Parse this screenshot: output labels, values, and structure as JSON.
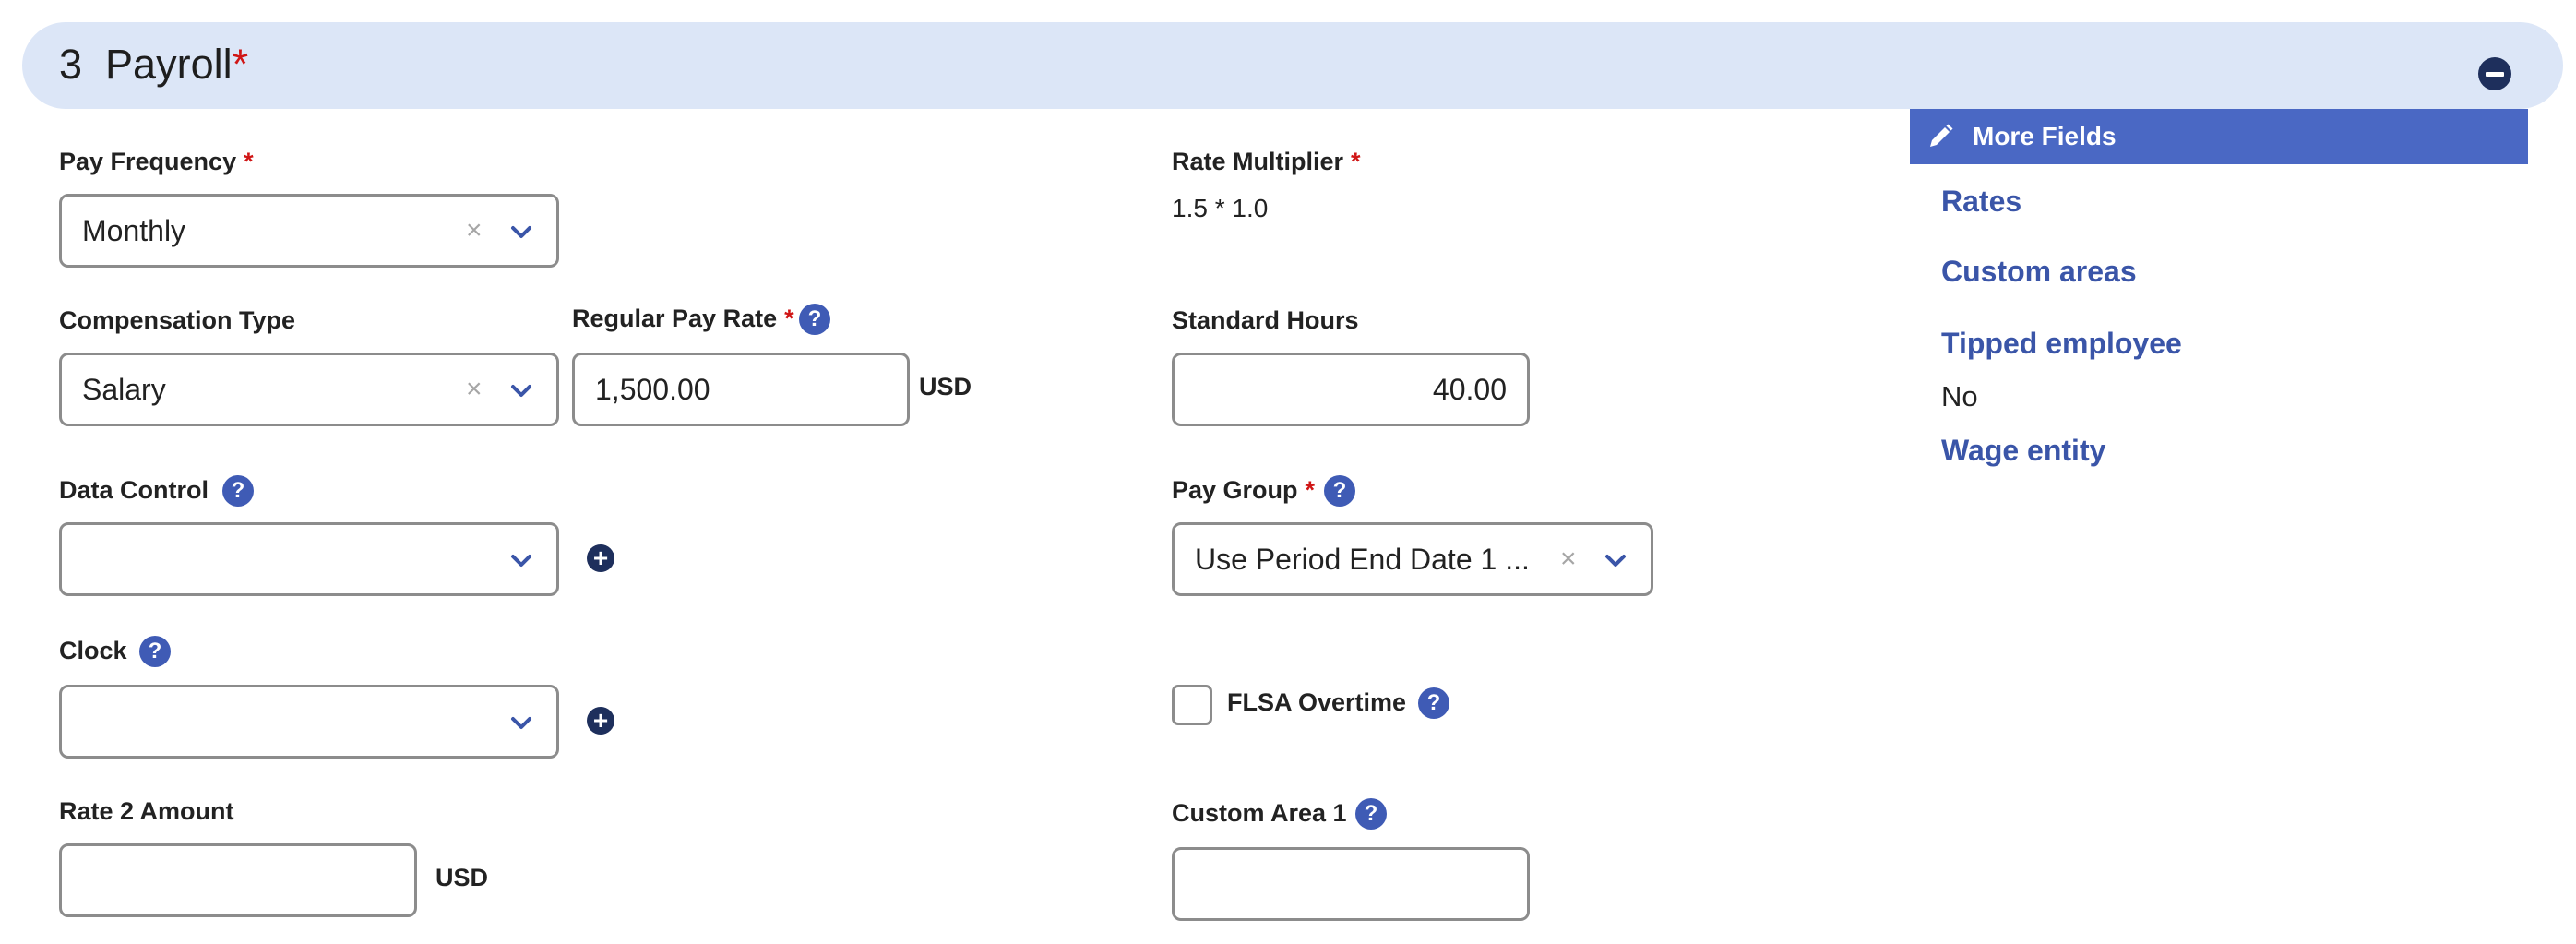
{
  "section": {
    "number": "3",
    "title": "Payroll",
    "required_marker": "*"
  },
  "fields": {
    "pay_frequency": {
      "label": "Pay Frequency",
      "required": "*",
      "value": "Monthly"
    },
    "rate_multiplier": {
      "label": "Rate Multiplier",
      "required": "*",
      "value": "1.5 * 1.0"
    },
    "compensation_type": {
      "label": "Compensation Type",
      "value": "Salary"
    },
    "regular_pay_rate": {
      "label": "Regular Pay Rate",
      "required": "*",
      "value": "1,500.00",
      "unit": "USD"
    },
    "standard_hours": {
      "label": "Standard Hours",
      "value": "40.00"
    },
    "data_control": {
      "label": "Data Control",
      "value": ""
    },
    "pay_group": {
      "label": "Pay Group",
      "required": "*",
      "value": "Use Period End Date 1 ..."
    },
    "clock": {
      "label": "Clock",
      "value": ""
    },
    "flsa_overtime": {
      "label": "FLSA Overtime",
      "checked": false
    },
    "rate2_amount": {
      "label": "Rate 2 Amount",
      "value": "",
      "unit": "USD"
    },
    "custom_area1": {
      "label": "Custom Area 1",
      "value": ""
    }
  },
  "side_panel": {
    "header": "More Fields",
    "rates_link": "Rates",
    "custom_areas_link": "Custom areas",
    "tipped_employee_link": "Tipped employee",
    "tipped_employee_value": "No",
    "wage_entity_link": "Wage entity"
  },
  "icons": {
    "help": "?",
    "clear": "×",
    "plus": "+"
  },
  "colors": {
    "header_bg": "#dce6f7",
    "accent": "#3f5bb5",
    "more_fields_bg": "#4a68c4",
    "link": "#3a55a8",
    "required": "#d01616",
    "dark_icon": "#1e2f5c"
  }
}
